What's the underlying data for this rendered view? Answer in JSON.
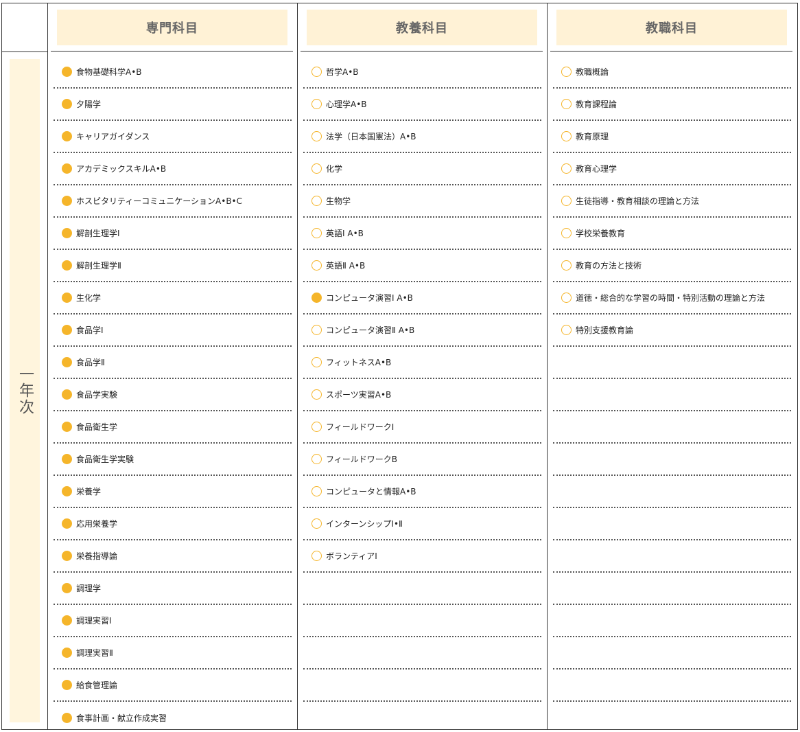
{
  "year": "一年次",
  "accent_color": "#f5b52a",
  "header_bg_color": "#fff2d6",
  "columns": [
    {
      "title": "専門科目",
      "items": [
        {
          "label": "食物基礎科学A•B",
          "filled": true
        },
        {
          "label": "夕陽学",
          "filled": true
        },
        {
          "label": "キャリアガイダンス",
          "filled": true
        },
        {
          "label": "アカデミックスキルA•B",
          "filled": true
        },
        {
          "label": "ホスピタリティーコミュニケーションA•B•C",
          "filled": true
        },
        {
          "label": "解剖生理学Ⅰ",
          "filled": true
        },
        {
          "label": "解剖生理学Ⅱ",
          "filled": true
        },
        {
          "label": "生化学",
          "filled": true
        },
        {
          "label": "食品学Ⅰ",
          "filled": true
        },
        {
          "label": "食品学Ⅱ",
          "filled": true
        },
        {
          "label": "食品学実験",
          "filled": true
        },
        {
          "label": "食品衛生学",
          "filled": true
        },
        {
          "label": "食品衛生学実験",
          "filled": true
        },
        {
          "label": "栄養学",
          "filled": true
        },
        {
          "label": "応用栄養学",
          "filled": true
        },
        {
          "label": "栄養指導論",
          "filled": true
        },
        {
          "label": "調理学",
          "filled": true
        },
        {
          "label": "調理実習Ⅰ",
          "filled": true
        },
        {
          "label": "調理実習Ⅱ",
          "filled": true
        },
        {
          "label": "給食管理論",
          "filled": true
        },
        {
          "label": "食事計画・献立作成実習",
          "filled": true
        }
      ]
    },
    {
      "title": "教養科目",
      "items": [
        {
          "label": "哲学A•B",
          "filled": false
        },
        {
          "label": "心理学A•B",
          "filled": false
        },
        {
          "label": "法学（日本国憲法）A•B",
          "filled": false
        },
        {
          "label": "化学",
          "filled": false
        },
        {
          "label": "生物学",
          "filled": false
        },
        {
          "label": "英語Ⅰ A•B",
          "filled": false
        },
        {
          "label": "英語Ⅱ A•B",
          "filled": false
        },
        {
          "label": "コンピュータ演習Ⅰ A•B",
          "filled": true
        },
        {
          "label": "コンピュータ演習Ⅱ A•B",
          "filled": false
        },
        {
          "label": "フィットネスA•B",
          "filled": false
        },
        {
          "label": "スポーツ実習A•B",
          "filled": false
        },
        {
          "label": "フィールドワークⅠ",
          "filled": false
        },
        {
          "label": "フィールドワークB",
          "filled": false
        },
        {
          "label": "コンピュータと情報A•B",
          "filled": false
        },
        {
          "label": "インターンシップⅠ•Ⅱ",
          "filled": false
        },
        {
          "label": "ボランティアⅠ",
          "filled": false
        }
      ]
    },
    {
      "title": "教職科目",
      "items": [
        {
          "label": "教職概論",
          "filled": false
        },
        {
          "label": "教育課程論",
          "filled": false
        },
        {
          "label": "教育原理",
          "filled": false
        },
        {
          "label": "教育心理学",
          "filled": false
        },
        {
          "label": "生徒指導・教育相談の理論と方法",
          "filled": false
        },
        {
          "label": "学校栄養教育",
          "filled": false
        },
        {
          "label": "教育の方法と技術",
          "filled": false
        },
        {
          "label": "道徳・総合的な学習の時間・特別活動の理論と方法",
          "filled": false
        },
        {
          "label": "特別支援教育論",
          "filled": false
        }
      ]
    }
  ]
}
